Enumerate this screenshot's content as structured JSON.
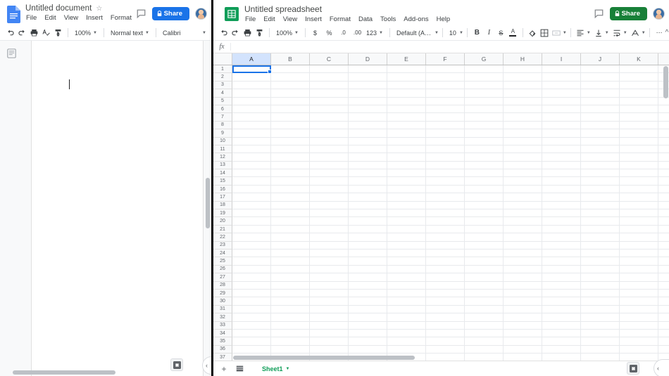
{
  "docs": {
    "app_icon": "docs-file-icon",
    "title": "Untitled document",
    "star_icon": "star-icon",
    "menus": [
      "File",
      "Edit",
      "View",
      "Insert",
      "Format"
    ],
    "comment_icon": "comment-icon",
    "share_label": "Share",
    "share_color": "#1a73e8",
    "lock_icon": "lock-icon",
    "avatar_icon": "user-avatar",
    "toolbar": {
      "undo_icon": "undo-icon",
      "redo_icon": "redo-icon",
      "print_icon": "print-icon",
      "spellcheck_icon": "spellcheck-icon",
      "paint_format_icon": "paint-format-icon",
      "zoom_value": "100%",
      "style_value": "Normal text",
      "font_value": "Calibri",
      "more_icon": "more-options-icon"
    },
    "outline_icon": "document-outline-icon",
    "explore_icon": "explore-icon",
    "collapse_icon": "chevron-left-icon"
  },
  "sheets": {
    "app_icon": "sheets-file-icon",
    "title": "Untitled spreadsheet",
    "menus": [
      "File",
      "Edit",
      "View",
      "Insert",
      "Format",
      "Data",
      "Tools",
      "Add-ons",
      "Help"
    ],
    "comment_icon": "comment-icon",
    "share_label": "Share",
    "share_color": "#188038",
    "lock_icon": "lock-icon",
    "avatar_icon": "user-avatar",
    "collapse_toolbar_icon": "chevron-up-icon",
    "toolbar": {
      "undo_icon": "undo-icon",
      "redo_icon": "redo-icon",
      "print_icon": "print-icon",
      "paint_format_icon": "paint-format-icon",
      "zoom_value": "100%",
      "currency_label": "$",
      "percent_label": "%",
      "decimal_decrease_label": ".0",
      "decimal_increase_label": ".00",
      "number_format_label": "123",
      "font_value": "Default (Ari...",
      "font_size_value": "10",
      "bold_label": "B",
      "italic_label": "I",
      "strikethrough_label": "S",
      "text_color_label": "A",
      "fill_color_icon": "fill-color-icon",
      "borders_icon": "borders-icon",
      "merge_cells_icon": "merge-cells-icon",
      "halign_icon": "horizontal-align-icon",
      "valign_icon": "vertical-align-icon",
      "text_wrap_icon": "text-wrap-icon",
      "text_rotation_icon": "text-rotation-icon",
      "more_icon": "more-options-icon"
    },
    "formula_bar": {
      "fx_label": "fx",
      "value": ""
    },
    "grid": {
      "columns": [
        "A",
        "B",
        "C",
        "D",
        "E",
        "F",
        "G",
        "H",
        "I",
        "J",
        "K"
      ],
      "selected_cell": "A1",
      "first_row": 1,
      "last_row": 37,
      "row_count": 37
    },
    "sheetbar": {
      "add_sheet_icon": "add-sheet-icon",
      "all_sheets_icon": "all-sheets-icon",
      "tab_label": "Sheet1",
      "tab_caret_icon": "chevron-down-icon",
      "explore_icon": "explore-icon",
      "collapse_icon": "chevron-left-icon"
    }
  }
}
